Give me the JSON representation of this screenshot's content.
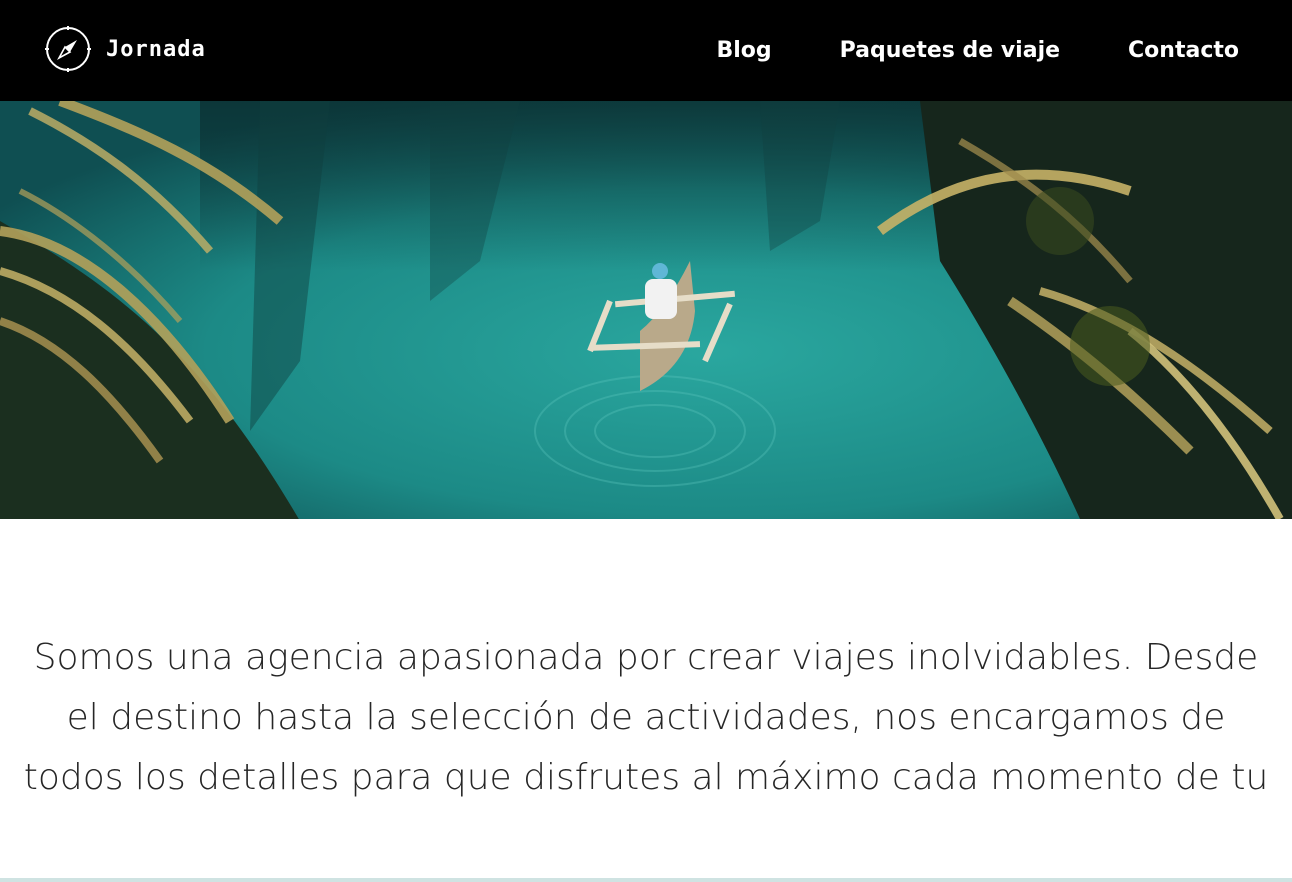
{
  "brand": {
    "name": "Jornada",
    "icon": "compass-icon"
  },
  "nav": {
    "items": [
      {
        "label": "Blog"
      },
      {
        "label": "Paquetes de viaje"
      },
      {
        "label": "Contacto"
      }
    ]
  },
  "hero": {
    "content": "boat-on-river-image"
  },
  "intro": {
    "text": "Somos una agencia apasionada por crear viajes inolvidables. Desde el destino hasta la selección de actividades, nos encargamos de todos los detalles para que disfrutes al máximo cada momento de tu"
  },
  "colors": {
    "header_bg": "#000000",
    "header_text": "#ffffff",
    "body_text": "#262626",
    "water": "#1f8f89"
  }
}
